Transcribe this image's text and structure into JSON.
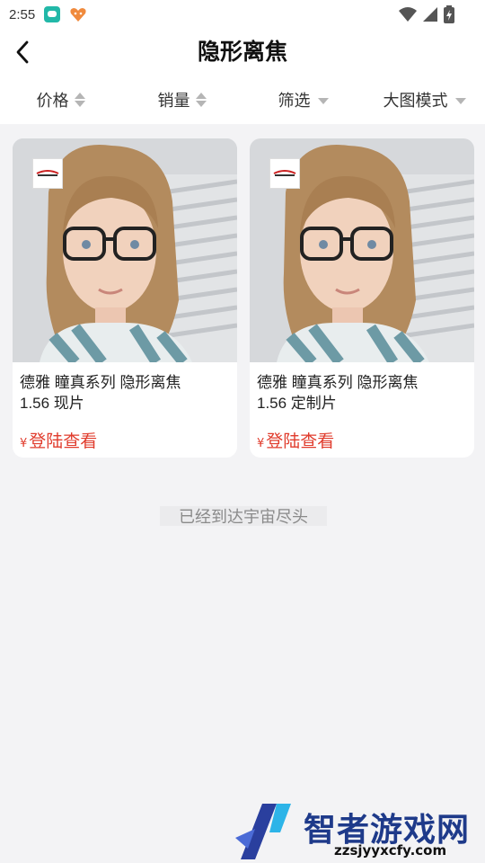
{
  "status_bar": {
    "time": "2:55"
  },
  "header": {
    "title": "隐形离焦"
  },
  "filters": [
    {
      "label": "价格",
      "kind": "sort"
    },
    {
      "label": "销量",
      "kind": "sort"
    },
    {
      "label": "筛选",
      "kind": "dropdown"
    },
    {
      "label": "大图模式",
      "kind": "dropdown"
    }
  ],
  "products": [
    {
      "title_line1": "德雅 瞳真系列 隐形离焦",
      "title_line2": "1.56 现片",
      "currency": "¥",
      "price_label": "登陆查看"
    },
    {
      "title_line1": "德雅 瞳真系列 隐形离焦",
      "title_line2": "1.56 定制片",
      "currency": "¥",
      "price_label": "登陆查看"
    }
  ],
  "end_note": "已经到达宇宙尽头",
  "watermark": {
    "title": "智者游戏网",
    "subtitle": "zzsjyyxcfy.com"
  },
  "colors": {
    "price": "#e03c2d",
    "accent": "#1e3a8a",
    "background": "#f3f3f5"
  }
}
